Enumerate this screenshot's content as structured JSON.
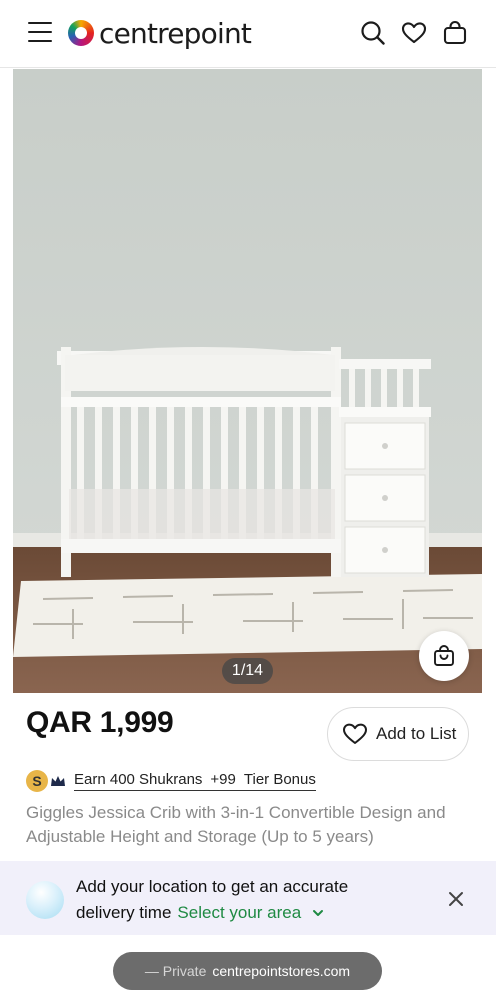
{
  "header": {
    "brand": "centrepoint",
    "icons": [
      "menu-icon",
      "search-icon",
      "heart-icon",
      "shopping-bag-icon"
    ]
  },
  "gallery": {
    "counter": "1/14"
  },
  "product": {
    "price": "QAR 1,999",
    "add_to_list_label": "Add to List",
    "shukran_earn": "Earn 400 Shukrans",
    "shukran_bonus": "+99",
    "shukran_tier": "Tier Bonus",
    "shukran_badge": "S",
    "title": "Giggles Jessica Crib with 3-in-1 Convertible Design and Adjustable Height and Storage (Up to 5 years)"
  },
  "location_banner": {
    "line1": "Add your location to get an accurate",
    "line2": "delivery time",
    "link": "Select your area"
  },
  "browser": {
    "private_label": "— Private",
    "domain": "centrepointstores.com"
  },
  "colors": {
    "accent_green": "#1f8a43",
    "banner_bg": "#f1f0fa",
    "badge_gold": "#e8b548"
  }
}
